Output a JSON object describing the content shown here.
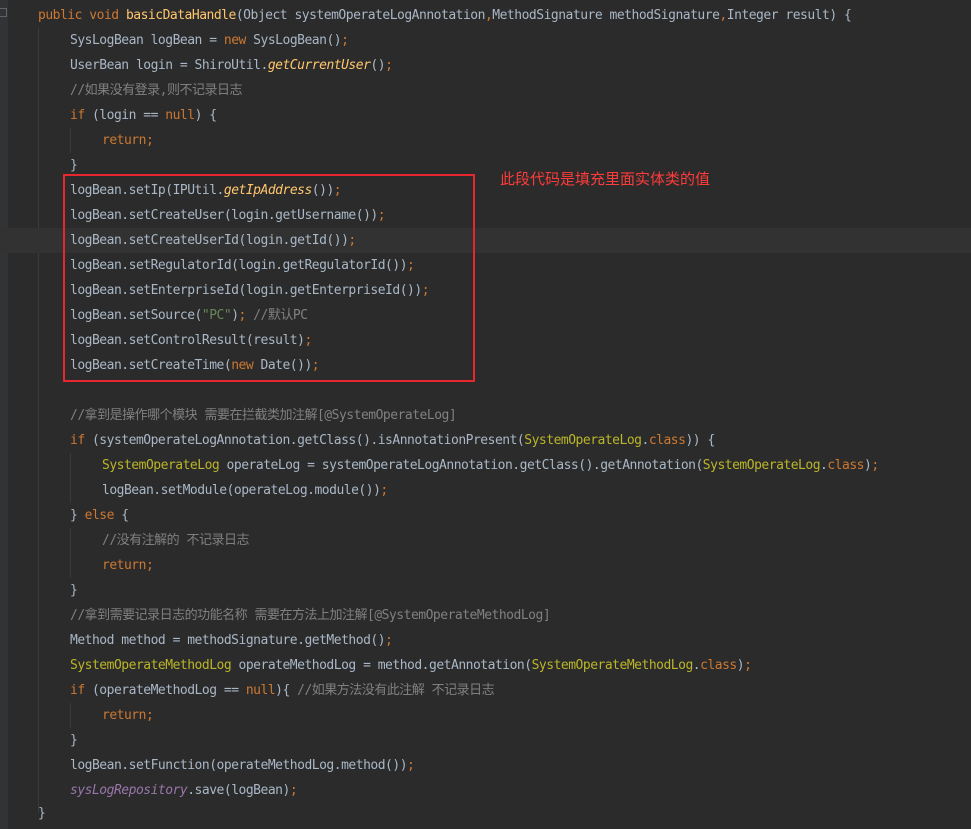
{
  "annotation": {
    "text": "此段代码是填充里面实体类的值",
    "color": "#ff3b3b"
  },
  "colors": {
    "background": "#2b2b2b",
    "keyword": "#cc7832",
    "method": "#ffc66d",
    "string": "#6a8759",
    "comment": "#808080",
    "annotation_type": "#bbb529",
    "default_text": "#a9b7c6",
    "field": "#9876aa",
    "highlight_border": "#e8262e"
  },
  "icons": {
    "fold": "fold-marker-icon"
  },
  "code_lines": [
    [
      [
        "kw",
        "public"
      ],
      [
        "p",
        " "
      ],
      [
        "kw",
        "void"
      ],
      [
        "p",
        " "
      ],
      [
        "fn",
        "basicDataHandle"
      ],
      [
        "p",
        "(Object systemOperateLogAnnotation"
      ],
      [
        "kw",
        ","
      ],
      [
        "p",
        "MethodSignature methodSignature"
      ],
      [
        "kw",
        ","
      ],
      [
        "p",
        "Integer result) {"
      ]
    ],
    [
      [
        "p",
        "SysLogBean logBean = "
      ],
      [
        "kw",
        "new"
      ],
      [
        "p",
        " SysLogBean()"
      ],
      [
        "kw",
        ";"
      ]
    ],
    [
      [
        "p",
        "UserBean login = ShiroUtil."
      ],
      [
        "it",
        "getCurrentUser"
      ],
      [
        "p",
        "()"
      ],
      [
        "kw",
        ";"
      ]
    ],
    [
      [
        "cm",
        "//如果没有登录,则不记录日志"
      ]
    ],
    [
      [
        "kw",
        "if"
      ],
      [
        "p",
        " (login == "
      ],
      [
        "kw",
        "null"
      ],
      [
        "p",
        ") {"
      ]
    ],
    [
      [
        "kw",
        "return;"
      ]
    ],
    [
      [
        "p",
        "}"
      ]
    ],
    [
      [
        "p",
        "logBean.setIp(IPUtil."
      ],
      [
        "it",
        "getIpAddress"
      ],
      [
        "p",
        "())"
      ],
      [
        "kw",
        ";"
      ]
    ],
    [
      [
        "p",
        "logBean.setCreateUser(login.getUsername())"
      ],
      [
        "kw",
        ";"
      ]
    ],
    [
      [
        "p",
        "logBean.setCreateUserId(login.getId())"
      ],
      [
        "kw",
        ";"
      ]
    ],
    [
      [
        "p",
        "logBean.setRegulatorId(login.getRegulatorId())"
      ],
      [
        "kw",
        ";"
      ]
    ],
    [
      [
        "p",
        "logBean.setEnterpriseId(login.getEnterpriseId())"
      ],
      [
        "kw",
        ";"
      ]
    ],
    [
      [
        "p",
        "logBean.setSource("
      ],
      [
        "str",
        "\"PC\""
      ],
      [
        "p",
        ")"
      ],
      [
        "kw",
        ";"
      ],
      [
        "p",
        " "
      ],
      [
        "cm",
        "//默认PC"
      ]
    ],
    [
      [
        "p",
        "logBean.setControlResult(result)"
      ],
      [
        "kw",
        ";"
      ]
    ],
    [
      [
        "p",
        "logBean.setCreateTime("
      ],
      [
        "kw",
        "new"
      ],
      [
        "p",
        " Date())"
      ],
      [
        "kw",
        ";"
      ]
    ],
    [],
    [
      [
        "cm",
        "//拿到是操作哪个模块 需要在拦截类加注解[@SystemOperateLog]"
      ]
    ],
    [
      [
        "kw",
        "if"
      ],
      [
        "p",
        " (systemOperateLogAnnotation.getClass().isAnnotationPresent("
      ],
      [
        "cls",
        "SystemOperateLog"
      ],
      [
        "p",
        "."
      ],
      [
        "kw",
        "class"
      ],
      [
        "p",
        ")) {"
      ]
    ],
    [
      [
        "cls",
        "SystemOperateLog"
      ],
      [
        "p",
        " operateLog = systemOperateLogAnnotation.getClass().getAnnotation("
      ],
      [
        "cls",
        "SystemOperateLog"
      ],
      [
        "p",
        "."
      ],
      [
        "kw",
        "class"
      ],
      [
        "p",
        ")"
      ],
      [
        "kw",
        ";"
      ]
    ],
    [
      [
        "p",
        "logBean.setModule(operateLog.module())"
      ],
      [
        "kw",
        ";"
      ]
    ],
    [
      [
        "p",
        "} "
      ],
      [
        "kw",
        "else"
      ],
      [
        "p",
        " {"
      ]
    ],
    [
      [
        "cm",
        "//没有注解的 不记录日志"
      ]
    ],
    [
      [
        "kw",
        "return;"
      ]
    ],
    [
      [
        "p",
        "}"
      ]
    ],
    [
      [
        "cm",
        "//拿到需要记录日志的功能名称 需要在方法上加注解[@SystemOperateMethodLog]"
      ]
    ],
    [
      [
        "p",
        "Method method = methodSignature.getMethod()"
      ],
      [
        "kw",
        ";"
      ]
    ],
    [
      [
        "cls",
        "SystemOperateMethodLog"
      ],
      [
        "p",
        " operateMethodLog = method.getAnnotation("
      ],
      [
        "cls",
        "SystemOperateMethodLog"
      ],
      [
        "p",
        "."
      ],
      [
        "kw",
        "class"
      ],
      [
        "p",
        ")"
      ],
      [
        "kw",
        ";"
      ]
    ],
    [
      [
        "kw",
        "if"
      ],
      [
        "p",
        " (operateMethodLog == "
      ],
      [
        "kw",
        "null"
      ],
      [
        "p",
        "){ "
      ],
      [
        "cm",
        "//如果方法没有此注解 不记录日志"
      ]
    ],
    [
      [
        "kw",
        "return;"
      ]
    ],
    [
      [
        "p",
        "}"
      ]
    ],
    [
      [
        "p",
        "logBean.setFunction(operateMethodLog.method())"
      ],
      [
        "kw",
        ";"
      ]
    ],
    [
      [
        "fld",
        "sysLogRepository"
      ],
      [
        "p",
        ".save(logBean)"
      ],
      [
        "kw",
        ";"
      ]
    ],
    [
      [
        "p",
        "}"
      ]
    ]
  ]
}
